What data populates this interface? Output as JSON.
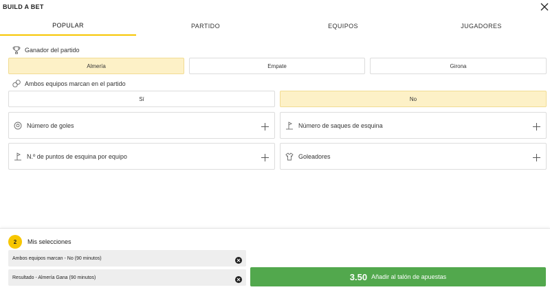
{
  "header": {
    "title": "BUILD A BET"
  },
  "tabs": [
    {
      "label": "POPULAR"
    },
    {
      "label": "PARTIDO"
    },
    {
      "label": "EQUIPOS"
    },
    {
      "label": "JUGADORES"
    }
  ],
  "markets": {
    "winner": {
      "title": "Ganador del partido",
      "options": [
        {
          "label": "Almería",
          "selected": true
        },
        {
          "label": "Empate",
          "selected": false
        },
        {
          "label": "Girona",
          "selected": false
        }
      ]
    },
    "btts": {
      "title": "Ambos equipos marcan en el partido",
      "options": [
        {
          "label": "Sí",
          "selected": false
        },
        {
          "label": "No",
          "selected": true
        }
      ]
    },
    "collapsed": [
      {
        "label": "Número de goles",
        "icon": "ball-icon"
      },
      {
        "label": "Número de saques de esquina",
        "icon": "corner-flag-icon"
      },
      {
        "label": "N.º de puntos de esquina por equipo",
        "icon": "corner-flag-icon"
      },
      {
        "label": "Goleadores",
        "icon": "shirt-icon"
      }
    ]
  },
  "footer": {
    "count": "2",
    "title": "Mis selecciones",
    "selections": [
      {
        "text": "Ambos equipos marcan - No (90 minutos)"
      },
      {
        "text": "Resultado - Almería Gana (90 minutos)"
      }
    ],
    "add_button": {
      "odds": "3.50",
      "label": "Añadir al talón de apuestas"
    }
  },
  "colors": {
    "accent": "#f7c600",
    "selected_bg": "#fdf1c7",
    "add_button": "#52a84d",
    "selection_row_bg": "#eeeeee"
  }
}
